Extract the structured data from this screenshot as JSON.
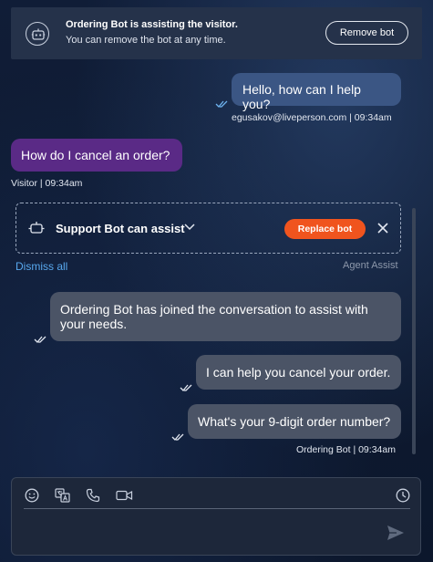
{
  "banner": {
    "title": "Ordering Bot is assisting the visitor.",
    "subtitle": "You can remove the bot at any time.",
    "remove_label": "Remove bot"
  },
  "messages": [
    {
      "text": "Hello, how can I help you?",
      "meta": "egusakov@liveperson.com  |  09:34am"
    },
    {
      "text": "How do I cancel an order?",
      "meta": "Visitor  |  09:34am"
    },
    {
      "text": "Ordering Bot has joined the conversation to assist with your needs."
    },
    {
      "text": "I can help you cancel your order."
    },
    {
      "text": "What's your 9-digit order number?",
      "meta": "Ordering Bot  |  09:34am"
    }
  ],
  "assist": {
    "title": "Support Bot can assist",
    "replace_label": "Replace bot",
    "dismiss_label": "Dismiss all",
    "source_label": "Agent Assist"
  },
  "composer": {
    "placeholder": "",
    "tools": [
      "emoji-icon",
      "translate-icon",
      "phone-icon",
      "video-icon",
      "clock-icon",
      "send-icon"
    ]
  },
  "colors": {
    "agent_bubble": "#3b5684",
    "visitor_bubble": "#5a2a86",
    "bot_bubble": "#4b5466",
    "accent_orange": "#f0541e",
    "link_blue": "#58a8ee",
    "read_check": "#6fb4f0"
  }
}
